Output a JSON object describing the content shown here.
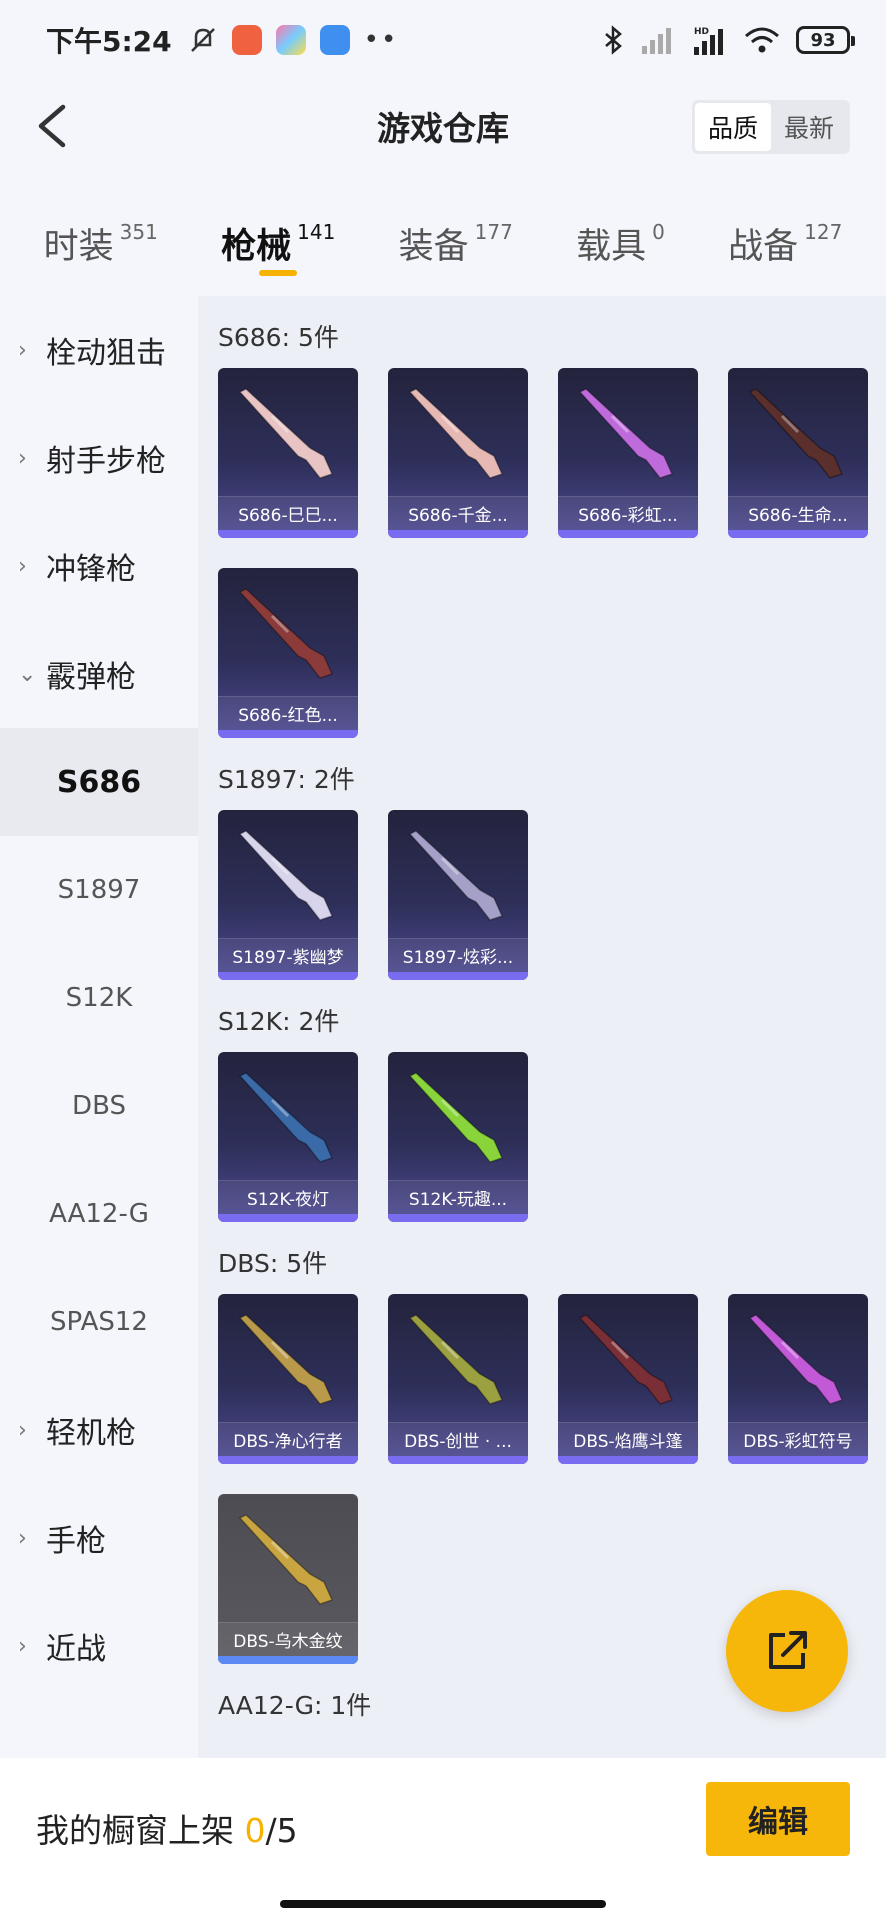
{
  "status_bar": {
    "time": "下午5:24",
    "battery": "93",
    "hd": "HD"
  },
  "header": {
    "title": "游戏仓库",
    "sort_options": [
      "品质",
      "最新"
    ],
    "sort_selected": "品质"
  },
  "tabs": [
    {
      "label": "时装",
      "count": "351"
    },
    {
      "label": "枪械",
      "count": "141",
      "active": true
    },
    {
      "label": "装备",
      "count": "177"
    },
    {
      "label": "载具",
      "count": "0"
    },
    {
      "label": "战备",
      "count": "127"
    }
  ],
  "categories": [
    {
      "label": "栓动狙击"
    },
    {
      "label": "射手步枪"
    },
    {
      "label": "冲锋枪"
    },
    {
      "label": "霰弹枪",
      "expanded": true
    },
    {
      "label": "轻机枪"
    },
    {
      "label": "手枪"
    },
    {
      "label": "近战"
    }
  ],
  "subcategories": [
    "S686",
    "S1897",
    "S12K",
    "DBS",
    "AA12-G",
    "SPAS12"
  ],
  "active_subcategory": "S686",
  "groups": [
    {
      "title": "S686: 5件",
      "items": [
        {
          "name": "S686-巳巳...",
          "gun": "#e8c4c4"
        },
        {
          "name": "S686-千金...",
          "gun": "#e6b9b5"
        },
        {
          "name": "S686-彩虹...",
          "gun": "#c06bdc"
        },
        {
          "name": "S686-生命...",
          "gun": "#5a2f2c"
        },
        {
          "name": "S686-红色...",
          "gun": "#8c3b3b"
        }
      ]
    },
    {
      "title": "S1897: 2件",
      "items": [
        {
          "name": "S1897-紫幽梦",
          "gun": "#d8d4ec"
        },
        {
          "name": "S1897-炫彩...",
          "gun": "#a5a0c8"
        }
      ]
    },
    {
      "title": "S12K: 2件",
      "items": [
        {
          "name": "S12K-夜灯",
          "gun": "#3a6aa8"
        },
        {
          "name": "S12K-玩趣...",
          "gun": "#88d43a"
        }
      ]
    },
    {
      "title": "DBS: 5件",
      "items": [
        {
          "name": "DBS-净心行者",
          "gun": "#b89a4a"
        },
        {
          "name": "DBS-创世 · ...",
          "gun": "#9ba040"
        },
        {
          "name": "DBS-焰鹰斗篷",
          "gun": "#7a2f36"
        },
        {
          "name": "DBS-彩虹符号",
          "gun": "#c25ad8"
        },
        {
          "name": "DBS-乌木金纹",
          "gun": "#c8a540",
          "gray": true
        }
      ]
    },
    {
      "title": "AA12-G: 1件",
      "items": []
    }
  ],
  "bottom": {
    "prefix": "我的橱窗上架 ",
    "count": "0",
    "total": "/5",
    "edit_label": "编辑"
  },
  "colors": {
    "accent": "#f7b60a",
    "card_bg": "#2e2f59",
    "card_stripe": "#7a6cf0"
  }
}
